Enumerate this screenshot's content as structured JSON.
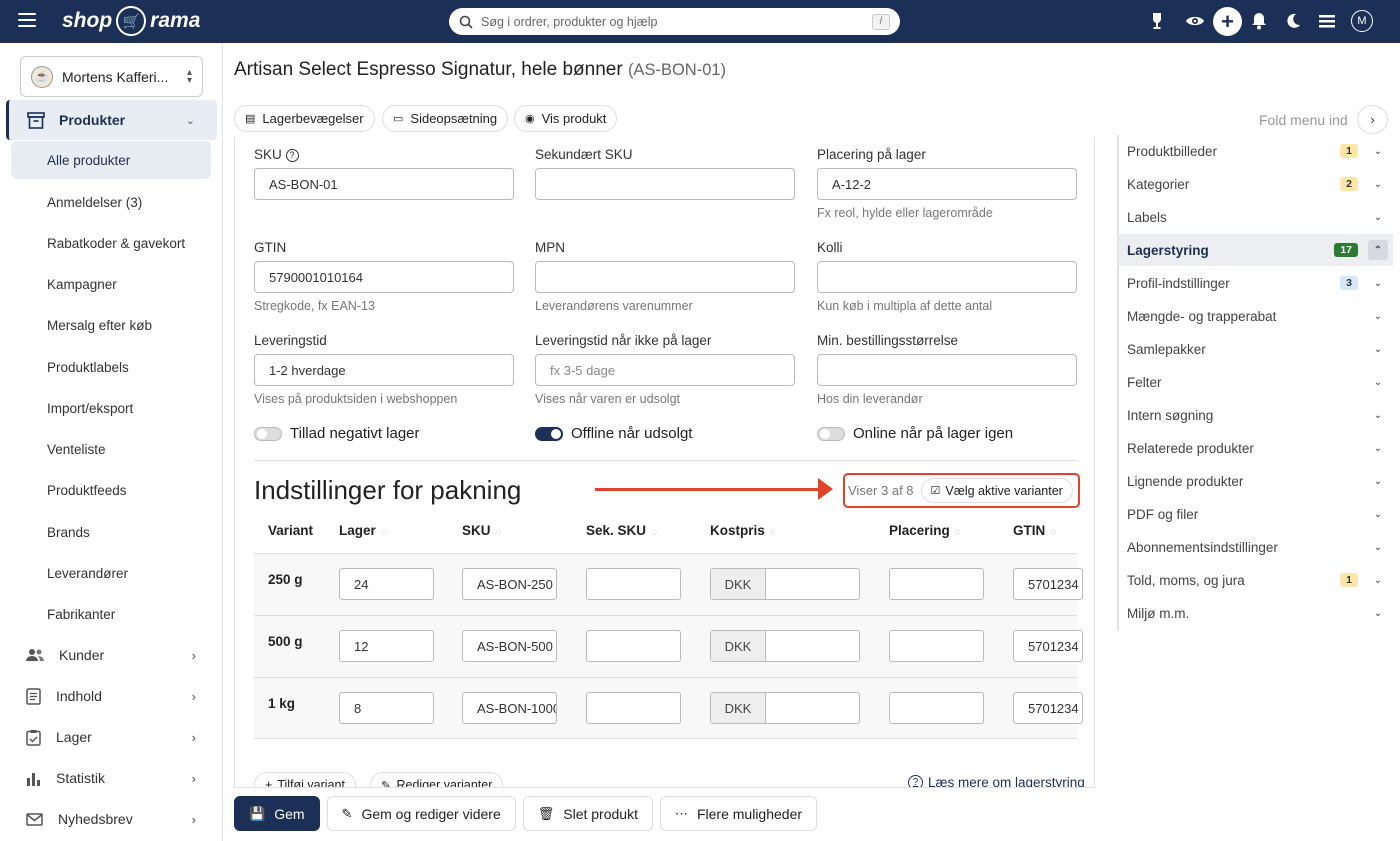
{
  "topbar": {
    "logo_text_left": "shop",
    "logo_text_right": "rama",
    "search_placeholder": "Søg i ordrer, produkter og hjælp",
    "search_shortcut": "/",
    "avatar_letter": "M"
  },
  "sidebar": {
    "store_name": "Mortens Kafferi...",
    "main_section": "Produkter",
    "sub_items": [
      "Alle produkter",
      "Anmeldelser (3)",
      "Rabatkoder & gavekort",
      "Kampagner",
      "Mersalg efter køb",
      "Produktlabels",
      "Import/eksport",
      "Venteliste",
      "Produktfeeds",
      "Brands",
      "Leverandører",
      "Fabrikanter"
    ],
    "sections": [
      "Kunder",
      "Indhold",
      "Lager",
      "Statistik",
      "Nyhedsbrev"
    ]
  },
  "page": {
    "title": "Artisan Select Espresso Signatur, hele bønner",
    "code": "(AS-BON-01)",
    "tabs": [
      "Lagerbevægelser",
      "Sideopsætning",
      "Vis produkt"
    ],
    "fold_menu": "Fold menu ind"
  },
  "form": {
    "sku_label": "SKU",
    "sku_value": "AS-BON-01",
    "sec_sku_label": "Sekundært SKU",
    "sec_sku_value": "",
    "location_label": "Placering på lager",
    "location_value": "A-12-2",
    "location_hint": "Fx reol, hylde eller lagerområde",
    "gtin_label": "GTIN",
    "gtin_value": "5790001010164",
    "gtin_hint": "Stregkode, fx EAN-13",
    "mpn_label": "MPN",
    "mpn_value": "",
    "mpn_hint": "Leverandørens varenummer",
    "kolli_label": "Kolli",
    "kolli_value": "",
    "kolli_hint": "Kun køb i multipla af dette antal",
    "delivery_label": "Leveringstid",
    "delivery_value": "1-2 hverdage",
    "delivery_hint": "Vises på produktsiden i webshoppen",
    "delivery_oos_label": "Leveringstid når ikke på lager",
    "delivery_oos_placeholder": "fx 3-5 dage",
    "delivery_oos_hint": "Vises når varen er udsolgt",
    "min_order_label": "Min. bestillingsstørrelse",
    "min_order_value": "",
    "min_order_hint": "Hos din leverandør",
    "toggle_negative": "Tillad negativt lager",
    "toggle_negative_on": false,
    "toggle_offline": "Offline når udsolgt",
    "toggle_offline_on": true,
    "toggle_online": "Online når på lager igen",
    "toggle_online_on": false
  },
  "packing": {
    "heading": "Indstillinger for pakning",
    "showing": "Viser 3 af 8",
    "choose_button": "Vælg aktive varianter",
    "columns": [
      "Variant",
      "Lager",
      "SKU",
      "Sek. SKU",
      "Kostpris",
      "Placering",
      "GTIN"
    ],
    "currency": "DKK",
    "rows": [
      {
        "variant": "250 g",
        "stock": "24",
        "sku": "AS-BON-250",
        "sec_sku": "",
        "cost": "",
        "location": "",
        "gtin": "5701234"
      },
      {
        "variant": "500 g",
        "stock": "12",
        "sku": "AS-BON-500",
        "sec_sku": "",
        "cost": "",
        "location": "",
        "gtin": "5701234"
      },
      {
        "variant": "1 kg",
        "stock": "8",
        "sku": "AS-BON-1000",
        "sec_sku": "",
        "cost": "",
        "location": "",
        "gtin": "5701234"
      }
    ],
    "add_variant": "Tilføj variant",
    "edit_variants": "Rediger varianter",
    "read_more": "Læs mere om lagerstyring"
  },
  "actions": {
    "save": "Gem",
    "save_continue": "Gem og rediger videre",
    "delete": "Slet produkt",
    "more": "Flere muligheder"
  },
  "right_panel": [
    {
      "label": "Produktbilleder",
      "badge": "1",
      "badge_color": "#fde6a8"
    },
    {
      "label": "Kategorier",
      "badge": "2",
      "badge_color": "#fde6a8"
    },
    {
      "label": "Labels",
      "badge": null
    },
    {
      "label": "Lagerstyring",
      "badge": "17",
      "badge_color": "#2f7a32",
      "active": true
    },
    {
      "label": "Profil-indstillinger",
      "badge": "3",
      "badge_color": "#d5e8fb"
    },
    {
      "label": "Mængde- og trapperabat",
      "badge": null
    },
    {
      "label": "Samlepakker",
      "badge": null
    },
    {
      "label": "Felter",
      "badge": null
    },
    {
      "label": "Intern søgning",
      "badge": null
    },
    {
      "label": "Relaterede produkter",
      "badge": null
    },
    {
      "label": "Lignende produkter",
      "badge": null
    },
    {
      "label": "PDF og filer",
      "badge": null
    },
    {
      "label": "Abonnementsindstillinger",
      "badge": null
    },
    {
      "label": "Told, moms, og jura",
      "badge": "1",
      "badge_color": "#fde6a8"
    },
    {
      "label": "Miljø m.m.",
      "badge": null
    }
  ],
  "colors": {
    "navy": "#1c2f57",
    "highlight": "#e0432a"
  }
}
